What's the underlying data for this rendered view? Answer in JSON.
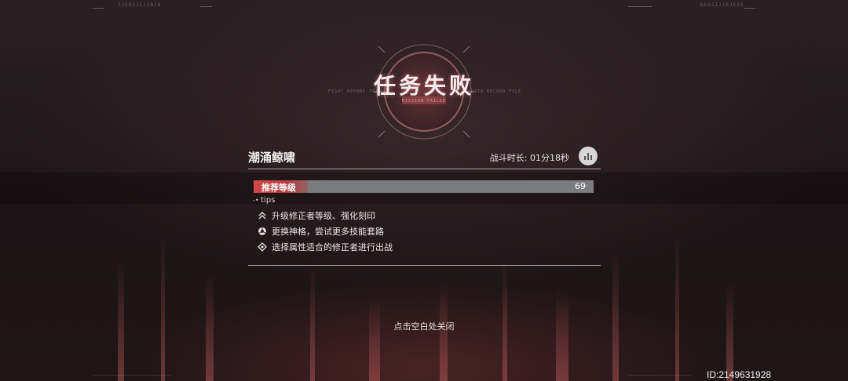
{
  "corners": {
    "top_left_code": "ZJEOIJIJ1NIN",
    "top_right_code": "NEBZIJIBJEJS"
  },
  "result": {
    "title": "任务失败",
    "subtitle": "MISSION FAILED",
    "side_left": "FIGHT REPORT TEXT",
    "side_right": "DATA RECORD FILE"
  },
  "stage": {
    "name": "潮涌鲸啸",
    "duration_label": "战斗时长: 01分18秒"
  },
  "recommended_level": {
    "label": "推荐等级",
    "value": "69",
    "fill_fraction": 0.16
  },
  "tips": {
    "label": "tips",
    "items": [
      {
        "icon": "upgrade-icon",
        "text": "升级修正者等级、强化刻印"
      },
      {
        "icon": "divinity-icon",
        "text": "更换神格，尝试更多技能套路"
      },
      {
        "icon": "element-icon",
        "text": "选择属性适合的修正者进行出战"
      }
    ]
  },
  "footer": {
    "close_hint": "点击空白处关闭",
    "id_label": "ID:2149631928"
  },
  "colors": {
    "accent": "#d44848",
    "bar_track": "#7b7c80"
  }
}
